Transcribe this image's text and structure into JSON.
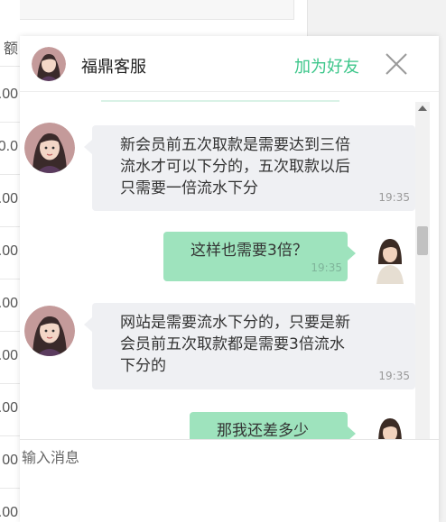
{
  "background": {
    "top_tab_label": "额",
    "cells": [
      ".00",
      "0.0",
      ".00",
      ".00",
      ".00",
      ".00",
      ".00",
      "00",
      ".00",
      "00"
    ]
  },
  "header": {
    "title": "福鼎客服",
    "add_friend": "加为好友",
    "accent_color": "#3cc68a",
    "avatar_icon": "agent-avatar-icon",
    "close_icon": "close-x-icon"
  },
  "messages": [
    {
      "direction": "in",
      "lines": [
        "新会员前五次取款是需要达到三倍",
        "流水才可以下分的，五次取款以后",
        "只需要一倍流水下分"
      ],
      "time": "19:35"
    },
    {
      "direction": "out",
      "lines": [
        "这样也需要3倍？"
      ],
      "time": "19:35"
    },
    {
      "direction": "in",
      "lines": [
        "网站是需要流水下分的，只要是新",
        "会员前五次取款都是需要3倍流水",
        "下分的"
      ],
      "time": "19:35"
    },
    {
      "direction": "out",
      "lines": [
        "那我还差多少"
      ],
      "time": ""
    }
  ],
  "input": {
    "placeholder": "输入消息"
  },
  "colors": {
    "incoming_bubble": "#eff0f3",
    "outgoing_bubble": "#9ee3bd"
  }
}
